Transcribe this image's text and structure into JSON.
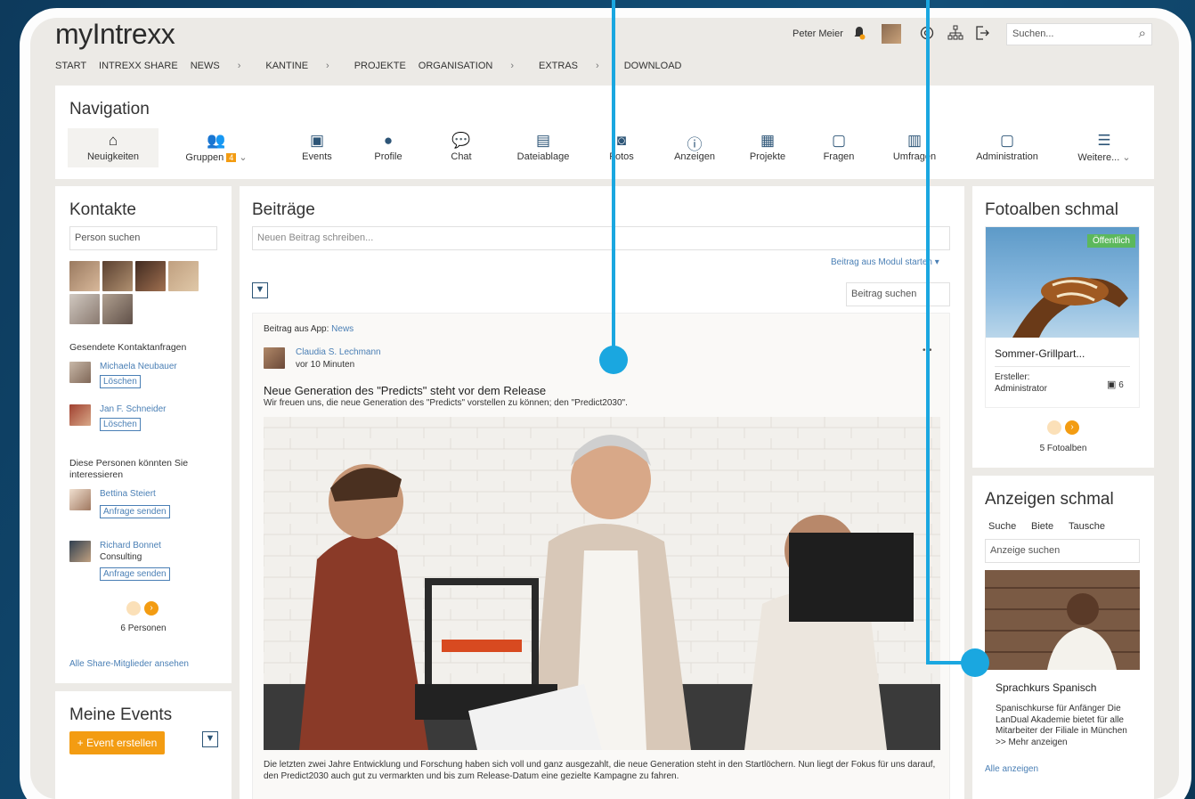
{
  "brand": {
    "logo_text": "myIntrexx"
  },
  "topnav": {
    "items": [
      "START",
      "INTREXX SHARE",
      "NEWS",
      "KANTINE",
      "PROJEKTE",
      "ORGANISATION",
      "EXTRAS",
      "DOWNLOAD"
    ]
  },
  "header": {
    "user_name": "Peter Meier",
    "search_placeholder": "Suchen..."
  },
  "navigation": {
    "title": "Navigation",
    "items": [
      {
        "label": "Neuigkeiten",
        "icon": "home-icon"
      },
      {
        "label": "Gruppen",
        "badge": "4",
        "icon": "group-icon"
      },
      {
        "label": "Events",
        "icon": "calendar-icon"
      },
      {
        "label": "Profile",
        "icon": "person-icon"
      },
      {
        "label": "Chat",
        "icon": "chat-icon"
      },
      {
        "label": "Dateiablage",
        "icon": "files-icon"
      },
      {
        "label": "Fotos",
        "icon": "camera-icon"
      },
      {
        "label": "Anzeigen",
        "icon": "info-icon"
      },
      {
        "label": "Projekte",
        "icon": "clipboard-icon"
      },
      {
        "label": "Fragen",
        "icon": "question-icon"
      },
      {
        "label": "Umfragen",
        "icon": "bar-chart-icon"
      },
      {
        "label": "Administration",
        "icon": "admin-icon"
      },
      {
        "label": "Weitere...",
        "icon": "more-icon"
      }
    ]
  },
  "contacts": {
    "title": "Kontakte",
    "search_placeholder": "Person suchen",
    "sent_requests_title": "Gesendete Kontaktanfragen",
    "sent_requests": [
      {
        "name": "Michaela Neubauer",
        "action": "Löschen"
      },
      {
        "name": "Jan F. Schneider",
        "action": "Löschen"
      }
    ],
    "suggestions_title": "Diese Personen könnten Sie interessieren",
    "suggestions": [
      {
        "name": "Bettina Steiert",
        "subtitle": "",
        "action": "Anfrage senden"
      },
      {
        "name": "Richard Bonnet",
        "subtitle": "Consulting",
        "action": "Anfrage senden"
      }
    ],
    "count_label": "6 Personen",
    "all_link": "Alle Share-Mitglieder ansehen"
  },
  "events": {
    "title": "Meine Events",
    "create_button": "+ Event erstellen"
  },
  "posts": {
    "title": "Beiträge",
    "new_post_placeholder": "Neuen Beitrag schreiben...",
    "module_link": "Beitrag aus Modul starten",
    "search_placeholder": "Beitrag suchen",
    "post": {
      "source_label": "Beitrag aus App:",
      "source_app": "News",
      "author": "Claudia S. Lechmann",
      "time": "vor 10 Minuten",
      "title": "Neue Generation des \"Predicts\" steht vor dem Release",
      "subtitle": "Wir freuen uns, die neue Generation des \"Predicts\" vorstellen zu können; den \"Predict2030\".",
      "body": "Die letzten zwei Jahre Entwicklung und Forschung haben sich voll und ganz ausgezahlt, die neue Generation steht in den Startlöchern. Nun liegt der Fokus für uns darauf, den Predict2030 auch gut zu vermarkten und bis zum Release-Datum eine gezielte Kampagne zu fahren.",
      "more_label": "•••"
    }
  },
  "photo_albums": {
    "title": "Fotoalben schmal",
    "badge": "Öffentlich",
    "album_title": "Sommer-Grillpart...",
    "creator_label": "Ersteller:",
    "creator_name": "Administrator",
    "photo_count": "6",
    "count_label": "5 Fotoalben"
  },
  "ads": {
    "title": "Anzeigen schmal",
    "tabs": [
      "Suche",
      "Biete",
      "Tausche"
    ],
    "search_placeholder": "Anzeige suchen",
    "ad_title": "Sprachkurs Spanisch",
    "ad_text": "Spanischkurse für Anfänger Die LanDual Akademie bietet für alle Mitarbeiter der Filiale in München Spanischkurse für",
    "more_link": ">> Mehr anzeigen",
    "all_link": "Alle anzeigen"
  },
  "colors": {
    "accent": "#f39c12",
    "link": "#4a7fb5",
    "callout": "#1aa7e0",
    "badge_green": "#5cb85c"
  }
}
